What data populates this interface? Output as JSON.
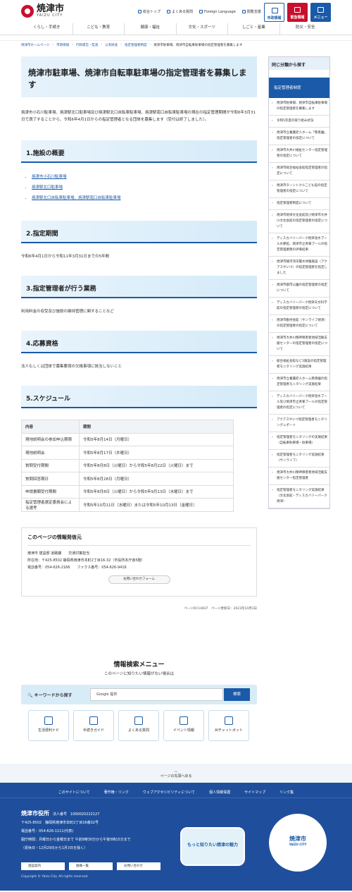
{
  "header": {
    "city_name": "焼津市",
    "city_name_en": "YAIZU CITY",
    "top_links": [
      "総合トップ",
      "よくある質問",
      "Foreign Language",
      "閲覧支援"
    ],
    "buttons": {
      "info": "市政情報",
      "emergency": "緊急情報",
      "menu": "メニュー"
    },
    "gnav": [
      "くらし・手続き",
      "こども・教育",
      "健康・福祉",
      "文化・スポーツ",
      "しごと・産業",
      "防災・安全"
    ]
  },
  "breadcrumb": [
    "焼津市ホームページ",
    "市政情報",
    "行政運営・監査",
    "公有財産",
    "指定管理者制度",
    "焼津市駐車場、焼津市自転車駐車場の指定管理者を募集します"
  ],
  "main": {
    "title": "焼津市駐車場、焼津市自転車駐車場の指定管理者を募集します",
    "intro": "焼津市小石川駐車場、焼津駅北口駐車場及び焼津駅北口自転車駐車場、焼津駅南口自転車駐車場の現在の指定管理期間が令和6年3月31日で満了することから、令和6年4月1日からの指定管理者となる団体を募集します（受付は終了しました）。",
    "s1": "1.施設の概要",
    "s1_links": [
      "焼津市小石川駐車場",
      "焼津駅北口駐車場",
      "焼津駅北口自転車駐車場、焼津駅南口自転車駐車場"
    ],
    "s2": "2.指定期間",
    "s2_text": "令和6年4月1日から令和11年3月31日までの5年間",
    "s3": "3.指定管理者が行う業務",
    "s3_text": "利用料金の収受及び施設の維持管理に関することなど",
    "s4": "4.応募資格",
    "s4_text": "法人もしくは団体で募集要領の欠格事項に該当しないこと",
    "s5": "5.スケジュール",
    "table_head": [
      "内容",
      "期間"
    ],
    "table_rows": [
      [
        "現地説明会の参加申込期限",
        "令和5年8月14日（月曜日）"
      ],
      [
        "現地説明会",
        "令和5年8月17日（木曜日）"
      ],
      [
        "質問受付期間",
        "令和5年8月8日（火曜日）から令和5年8月22日（火曜日）まで"
      ],
      [
        "質問回答期日",
        "令和5年8月28日（月曜日）"
      ],
      [
        "申請書類受付期間",
        "令和5年8月8日（火曜日）から令和5年9月13日（水曜日）まで"
      ],
      [
        "指定管理者選定委員会による選考",
        "令和5年10月11日（水曜日）または令和5年10月13日（金曜日）"
      ]
    ],
    "contact_title": "このページの情報発信元",
    "contact_lines": [
      "焼津市 建設部 道路課　　交通対策担当",
      "所在地：〒425-8502 静岡県焼津市本町2丁目16-32（市役所本庁舎5階）",
      "電話番号：054-626-2166　　ファクス番号：054-626-9416"
    ],
    "form_button": "お問い合わせフォーム",
    "page_id": "ページID:14837　ページ更新日：2023年10月3日"
  },
  "sidebar": {
    "heading": "同じ分類から探す",
    "active": "指定管理者制度",
    "items": [
      "焼津市駐車場、焼津市自転車駐車場の指定管理者を募集します",
      "令和5年度の取り組み状況",
      "焼津市立養護老人ホーム「慈恵園」指定管理者の指定について",
      "焼津市大井川福祉センター指定管理者の指定について",
      "焼津市総合福祉会館指定管理者の指定について",
      "焼津市ターントクルこども館の指定管理者の指定について",
      "指定管理者制度について",
      "焼津市焼津文化会館及び焼津市大井川文化会館の指定管理者の指定について",
      "ディスカバリーパーク焼津温水プール水夢館、焼津市立青峯プールの指定管理業務の評価結果",
      "焼津市駿河湾深層水体験施設（アクアスやいづ）の指定管理者を指定しました",
      "焼津市都市公園の指定管理者の指定について",
      "ディスカバリーパーク焼津天文科学館の指定管理者の指定について",
      "焼津市勤労会館（サンライフ焼津）の指定管理者の指定について",
      "焼津市大井川精神障害者地域活動支援センターの指定管理者の指定について",
      "総合福祉会館など3施設の指定管理者モニタリング実施結果",
      "焼津市立養護老人ホーム慈恵園の指定管理者モニタリング実施結果",
      "ディスカバリーパーク焼津温水プール及び焼津市立青峯プールの指定管理者の指定について",
      "アクアスやいづ指定管理者モニタリングレポート",
      "指定管理者モニタリングの実施結果（自転車駐車場・駐車場）",
      "指定管理者モニタリング実施結果（サンライフ）",
      "焼津市大井川精神障害者地域活動支援センター指定管理者",
      "指定管理者モニタリング実施結果（文化会館・ディスカバリーパーク焼津）"
    ]
  },
  "search": {
    "title": "情報検索メニュー",
    "subtitle": "このページに知りたい情報がない場合は",
    "keyword_label": "キーワードから探す",
    "input_placeholder": "Google 提供",
    "search_button": "検索",
    "tiles": [
      "生活便利ナビ",
      "手続きガイド",
      "よくある質問",
      "イベント情報",
      "AIチャットボット"
    ]
  },
  "pagetop": "ページの先頭へ戻る",
  "footer": {
    "links": [
      "このサイトについて",
      "著作権・リンク",
      "ウェブアクセシビリティについて",
      "個人情報保護",
      "サイトマップ",
      "リンク集"
    ],
    "name": "焼津市役所",
    "corp_no": "法人番号　1000020222127",
    "address": "〒425-8502　静岡県焼津市本町2丁目16番32号",
    "tel": "電話番号：054-626-1111(代表)",
    "hours": "開庁時間：月曜日から金曜日まで 午前8時30分から午後5時15分まで",
    "hours_note": "（祝休日・12月29日から1月3日を除く）",
    "buttons": [
      "施設案内",
      "組織一覧",
      "お問い合わせ"
    ],
    "copyright": "Copyright © Yaizu City. All rights reserved.",
    "badge": "もっと知りたい焼津の魅力",
    "map_city": "焼津市",
    "map_city_en": "YAIZU CITY"
  }
}
